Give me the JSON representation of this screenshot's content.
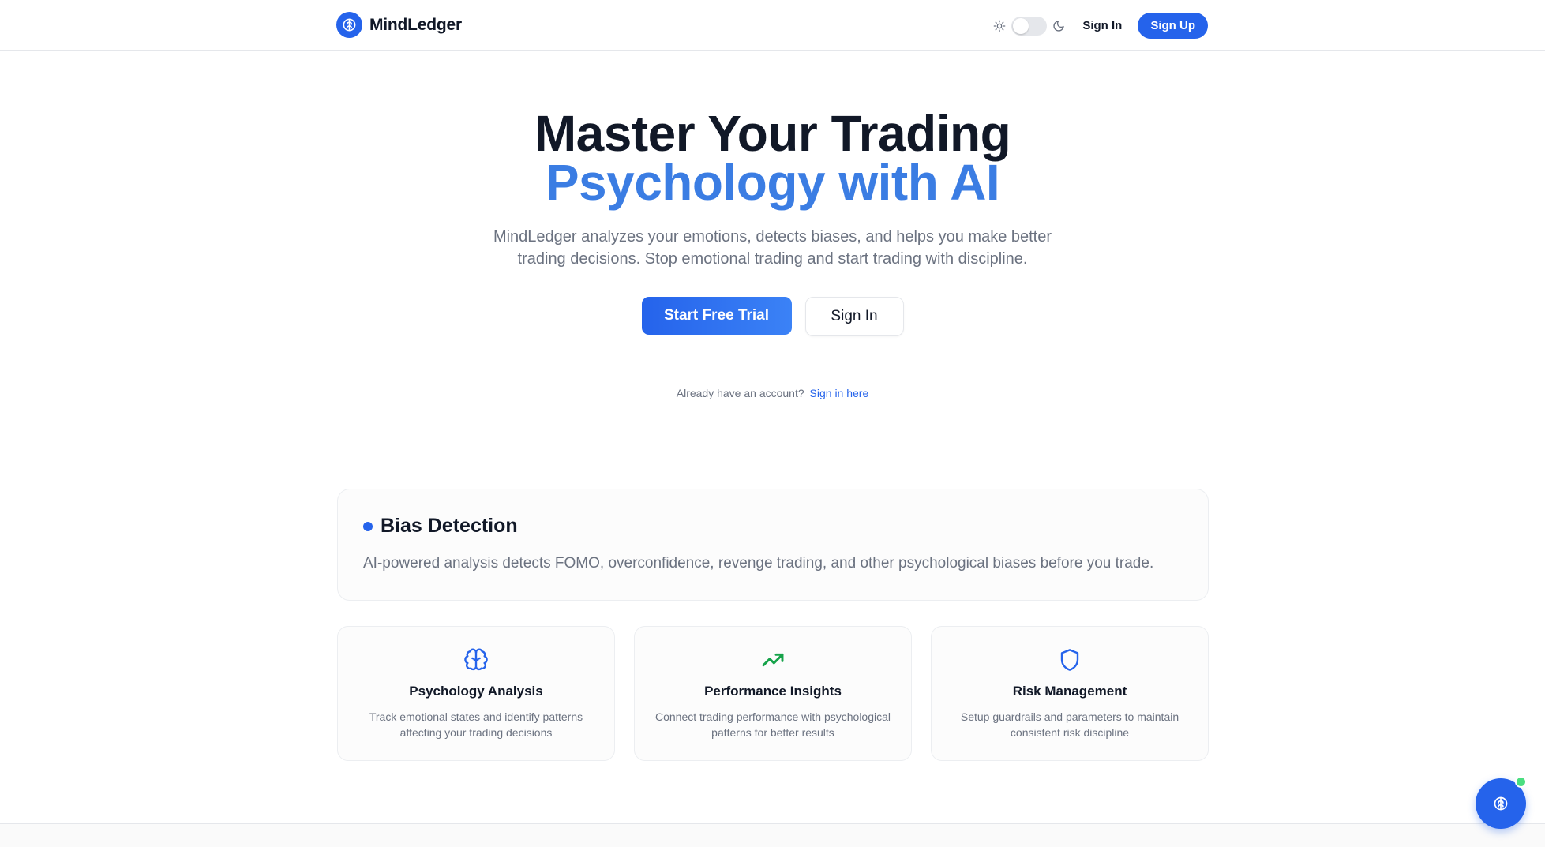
{
  "header": {
    "brand_name": "MindLedger",
    "sign_in_label": "Sign In",
    "sign_up_label": "Sign Up"
  },
  "hero": {
    "title_line1": "Master Your Trading",
    "title_line2": "Psychology with AI",
    "lead": "MindLedger analyzes your emotions, detects biases, and helps you make better trading decisions. Stop emotional trading and start trading with discipline.",
    "primary_cta": "Start Free Trial",
    "secondary_cta": "Sign In",
    "account_prompt": "Already have an account?",
    "account_link": "Sign in here"
  },
  "bias_card": {
    "title": "Bias Detection",
    "description": "AI-powered analysis detects FOMO, overconfidence, revenge trading, and other psychological biases before you trade."
  },
  "features": [
    {
      "icon": "brain-icon",
      "title": "Psychology Analysis",
      "description": "Track emotional states and identify patterns affecting your trading decisions"
    },
    {
      "icon": "trending-up-icon",
      "title": "Performance Insights",
      "description": "Connect trading performance with psychological patterns for better results"
    },
    {
      "icon": "shield-icon",
      "title": "Risk Management",
      "description": "Setup guardrails and parameters to maintain consistent risk discipline"
    }
  ],
  "colors": {
    "primary": "#2563eb",
    "accent_text": "#3b7de3",
    "success": "#16a34a",
    "online": "#4ade80"
  },
  "theme": {
    "mode": "light"
  }
}
